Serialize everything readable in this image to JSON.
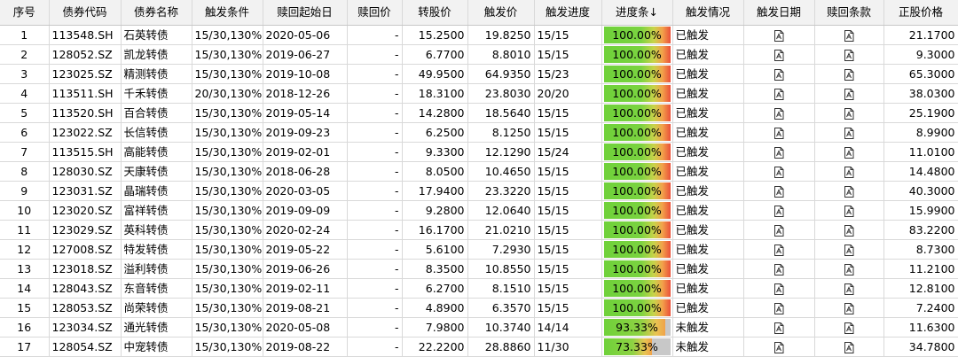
{
  "headers": [
    "序号",
    "债券代码",
    "债券名称",
    "触发条件",
    "赎回起始日",
    "赎回价",
    "转股价",
    "触发价",
    "触发进度",
    "进度条↓",
    "触发情况",
    "触发日期",
    "赎回条款",
    "正股价格"
  ],
  "rows": [
    {
      "no": "1",
      "code": "113548.SH",
      "name": "石英转债",
      "cond": "15/30,130%",
      "start": "2020-05-06",
      "redeem": "-",
      "conv": "15.2500",
      "trig": "19.8250",
      "prog": "15/15",
      "pct": 1.0,
      "pct_label": "100.00%",
      "status": "已触发",
      "stock": "21.1700"
    },
    {
      "no": "2",
      "code": "128052.SZ",
      "name": "凯龙转债",
      "cond": "15/30,130%",
      "start": "2019-06-27",
      "redeem": "-",
      "conv": "6.7700",
      "trig": "8.8010",
      "prog": "15/15",
      "pct": 1.0,
      "pct_label": "100.00%",
      "status": "已触发",
      "stock": "9.3000"
    },
    {
      "no": "3",
      "code": "123025.SZ",
      "name": "精测转债",
      "cond": "15/30,130%",
      "start": "2019-10-08",
      "redeem": "-",
      "conv": "49.9500",
      "trig": "64.9350",
      "prog": "15/23",
      "pct": 1.0,
      "pct_label": "100.00%",
      "status": "已触发",
      "stock": "65.3000"
    },
    {
      "no": "4",
      "code": "113511.SH",
      "name": "千禾转债",
      "cond": "20/30,130%",
      "start": "2018-12-26",
      "redeem": "-",
      "conv": "18.3100",
      "trig": "23.8030",
      "prog": "20/20",
      "pct": 1.0,
      "pct_label": "100.00%",
      "status": "已触发",
      "stock": "38.0300"
    },
    {
      "no": "5",
      "code": "113520.SH",
      "name": "百合转债",
      "cond": "15/30,130%",
      "start": "2019-05-14",
      "redeem": "-",
      "conv": "14.2800",
      "trig": "18.5640",
      "prog": "15/15",
      "pct": 1.0,
      "pct_label": "100.00%",
      "status": "已触发",
      "stock": "25.1900"
    },
    {
      "no": "6",
      "code": "123022.SZ",
      "name": "长信转债",
      "cond": "15/30,130%",
      "start": "2019-09-23",
      "redeem": "-",
      "conv": "6.2500",
      "trig": "8.1250",
      "prog": "15/15",
      "pct": 1.0,
      "pct_label": "100.00%",
      "status": "已触发",
      "stock": "8.9900"
    },
    {
      "no": "7",
      "code": "113515.SH",
      "name": "高能转债",
      "cond": "15/30,130%",
      "start": "2019-02-01",
      "redeem": "-",
      "conv": "9.3300",
      "trig": "12.1290",
      "prog": "15/24",
      "pct": 1.0,
      "pct_label": "100.00%",
      "status": "已触发",
      "stock": "11.0100"
    },
    {
      "no": "8",
      "code": "128030.SZ",
      "name": "天康转债",
      "cond": "15/30,130%",
      "start": "2018-06-28",
      "redeem": "-",
      "conv": "8.0500",
      "trig": "10.4650",
      "prog": "15/15",
      "pct": 1.0,
      "pct_label": "100.00%",
      "status": "已触发",
      "stock": "14.4800"
    },
    {
      "no": "9",
      "code": "123031.SZ",
      "name": "晶瑞转债",
      "cond": "15/30,130%",
      "start": "2020-03-05",
      "redeem": "-",
      "conv": "17.9400",
      "trig": "23.3220",
      "prog": "15/15",
      "pct": 1.0,
      "pct_label": "100.00%",
      "status": "已触发",
      "stock": "40.3000"
    },
    {
      "no": "10",
      "code": "123020.SZ",
      "name": "富祥转债",
      "cond": "15/30,130%",
      "start": "2019-09-09",
      "redeem": "-",
      "conv": "9.2800",
      "trig": "12.0640",
      "prog": "15/15",
      "pct": 1.0,
      "pct_label": "100.00%",
      "status": "已触发",
      "stock": "15.9900"
    },
    {
      "no": "11",
      "code": "123029.SZ",
      "name": "英科转债",
      "cond": "15/30,130%",
      "start": "2020-02-24",
      "redeem": "-",
      "conv": "16.1700",
      "trig": "21.0210",
      "prog": "15/15",
      "pct": 1.0,
      "pct_label": "100.00%",
      "status": "已触发",
      "stock": "83.2200"
    },
    {
      "no": "12",
      "code": "127008.SZ",
      "name": "特发转债",
      "cond": "15/30,130%",
      "start": "2019-05-22",
      "redeem": "-",
      "conv": "5.6100",
      "trig": "7.2930",
      "prog": "15/15",
      "pct": 1.0,
      "pct_label": "100.00%",
      "status": "已触发",
      "stock": "8.7300"
    },
    {
      "no": "13",
      "code": "123018.SZ",
      "name": "溢利转债",
      "cond": "15/30,130%",
      "start": "2019-06-26",
      "redeem": "-",
      "conv": "8.3500",
      "trig": "10.8550",
      "prog": "15/15",
      "pct": 1.0,
      "pct_label": "100.00%",
      "status": "已触发",
      "stock": "11.2100"
    },
    {
      "no": "14",
      "code": "128043.SZ",
      "name": "东音转债",
      "cond": "15/30,130%",
      "start": "2019-02-11",
      "redeem": "-",
      "conv": "6.2700",
      "trig": "8.1510",
      "prog": "15/15",
      "pct": 1.0,
      "pct_label": "100.00%",
      "status": "已触发",
      "stock": "12.8100"
    },
    {
      "no": "15",
      "code": "128053.SZ",
      "name": "尚荣转债",
      "cond": "15/30,130%",
      "start": "2019-08-21",
      "redeem": "-",
      "conv": "4.8900",
      "trig": "6.3570",
      "prog": "15/15",
      "pct": 1.0,
      "pct_label": "100.00%",
      "status": "已触发",
      "stock": "7.2400"
    },
    {
      "no": "16",
      "code": "123034.SZ",
      "name": "通光转债",
      "cond": "15/30,130%",
      "start": "2020-05-08",
      "redeem": "-",
      "conv": "7.9800",
      "trig": "10.3740",
      "prog": "14/14",
      "pct": 0.9333,
      "pct_label": "93.33%",
      "status": "未触发",
      "stock": "11.6300"
    },
    {
      "no": "17",
      "code": "128054.SZ",
      "name": "中宠转债",
      "cond": "15/30,130%",
      "start": "2019-08-22",
      "redeem": "-",
      "conv": "22.2200",
      "trig": "28.8860",
      "prog": "11/30",
      "pct": 0.7333,
      "pct_label": "73.33%",
      "status": "未触发",
      "stock": "34.7800"
    }
  ],
  "icons": {
    "trigger_date": "document-icon",
    "redeem_clause": "document-icon"
  }
}
